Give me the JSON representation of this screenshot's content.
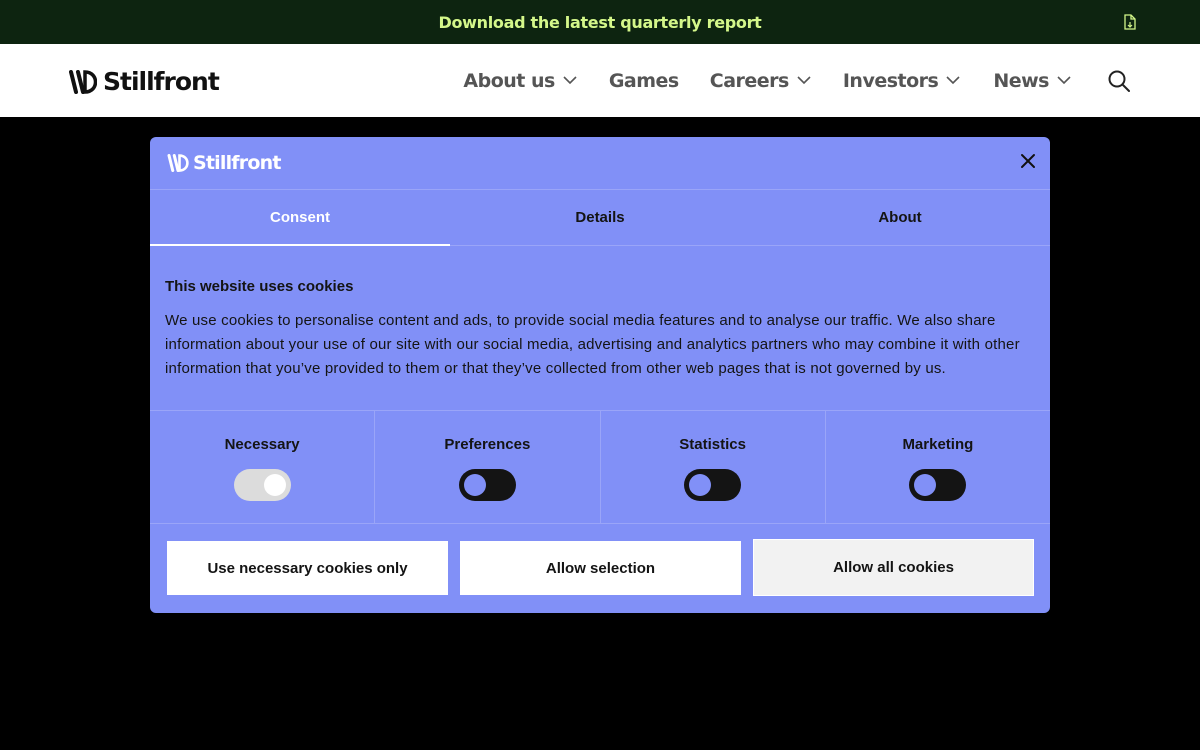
{
  "banner": {
    "link_text": "Download the latest quarterly report",
    "icon": "document-download-icon"
  },
  "header": {
    "logo_text": "Stillfront",
    "nav": [
      {
        "label": "About us",
        "has_dropdown": true
      },
      {
        "label": "Games",
        "has_dropdown": false
      },
      {
        "label": "Careers",
        "has_dropdown": true
      },
      {
        "label": "Investors",
        "has_dropdown": true
      },
      {
        "label": "News",
        "has_dropdown": true
      }
    ],
    "search_icon": "search-icon"
  },
  "cookie_dialog": {
    "logo_text": "Stillfront",
    "close_icon": "close-icon",
    "tabs": [
      {
        "label": "Consent",
        "active": true
      },
      {
        "label": "Details",
        "active": false
      },
      {
        "label": "About",
        "active": false
      }
    ],
    "title": "This website uses cookies",
    "description": "We use cookies to personalise content and ads, to provide social media features and to analyse our traffic. We also share information about your use of our site with our social media, advertising and analytics partners who may combine it with other information that you’ve provided to them or that they’ve collected from other web pages that is not governed by us.",
    "categories": [
      {
        "label": "Necessary",
        "enabled": true,
        "locked": true
      },
      {
        "label": "Preferences",
        "enabled": false
      },
      {
        "label": "Statistics",
        "enabled": false
      },
      {
        "label": "Marketing",
        "enabled": false
      }
    ],
    "buttons": {
      "necessary_only": "Use necessary cookies only",
      "allow_selection": "Allow selection",
      "allow_all": "Allow all cookies"
    }
  },
  "colors": {
    "banner_bg": "#0d2410",
    "banner_text": "#d4f78a",
    "dialog_bg": "#8190f7",
    "page_bg": "#000000"
  }
}
